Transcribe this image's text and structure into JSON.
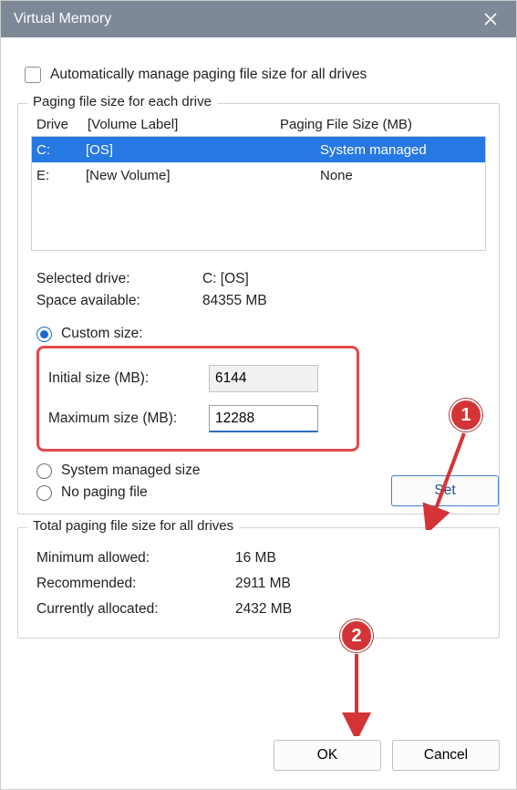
{
  "title": "Virtual Memory",
  "auto_label": "Automatically manage paging file size for all drives",
  "group_drives": {
    "legend": "Paging file size for each drive",
    "header": {
      "drive": "Drive",
      "vol": "[Volume Label]",
      "size": "Paging File Size (MB)"
    },
    "rows": [
      {
        "drive": "C:",
        "vol": "[OS]",
        "size": "System managed",
        "selected": true
      },
      {
        "drive": "E:",
        "vol": "[New Volume]",
        "size": "None",
        "selected": false
      }
    ],
    "selected_label": "Selected drive:",
    "selected_value": "C:  [OS]",
    "space_label": "Space available:",
    "space_value": "84355 MB",
    "custom_label": "Custom size:",
    "initial_label": "Initial size (MB):",
    "initial_value": "6144",
    "max_label": "Maximum size (MB):",
    "max_value": "12288",
    "sys_managed_label": "System managed size",
    "no_paging_label": "No paging file",
    "set_label": "Set"
  },
  "group_totals": {
    "legend": "Total paging file size for all drives",
    "min_label": "Minimum allowed:",
    "min_value": "16 MB",
    "rec_label": "Recommended:",
    "rec_value": "2911 MB",
    "cur_label": "Currently allocated:",
    "cur_value": "2432 MB"
  },
  "ok_label": "OK",
  "cancel_label": "Cancel",
  "badge1": "1",
  "badge2": "2"
}
